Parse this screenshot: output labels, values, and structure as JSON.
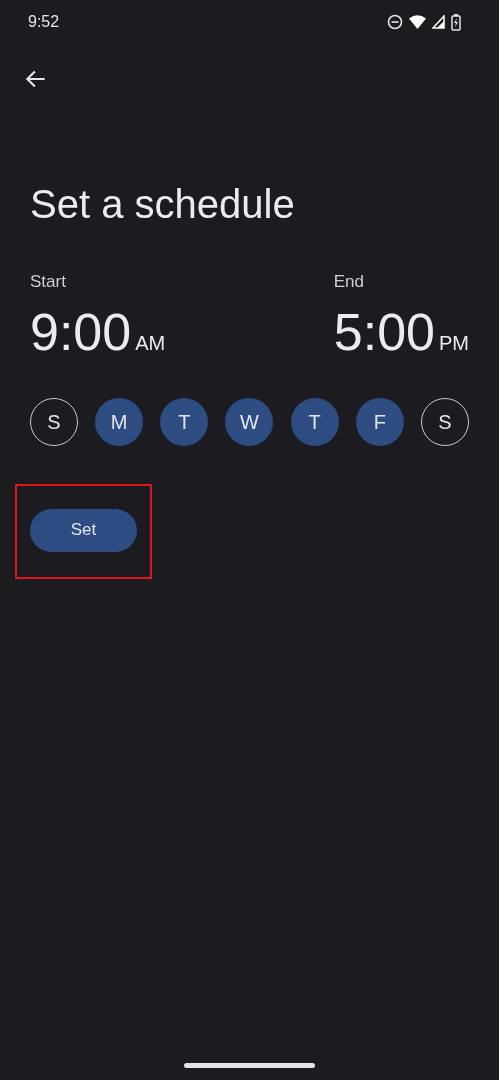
{
  "status_bar": {
    "time": "9:52"
  },
  "title": "Set a schedule",
  "times": [
    {
      "label": "Start",
      "time": "9:00",
      "period": "AM"
    },
    {
      "label": "End",
      "time": "5:00",
      "period": "PM"
    }
  ],
  "days": [
    {
      "label": "S",
      "selected": false
    },
    {
      "label": "M",
      "selected": true
    },
    {
      "label": "T",
      "selected": true
    },
    {
      "label": "W",
      "selected": true
    },
    {
      "label": "T",
      "selected": true
    },
    {
      "label": "F",
      "selected": true
    },
    {
      "label": "S",
      "selected": false
    }
  ],
  "set_button": {
    "label": "Set",
    "highlighted": true
  }
}
